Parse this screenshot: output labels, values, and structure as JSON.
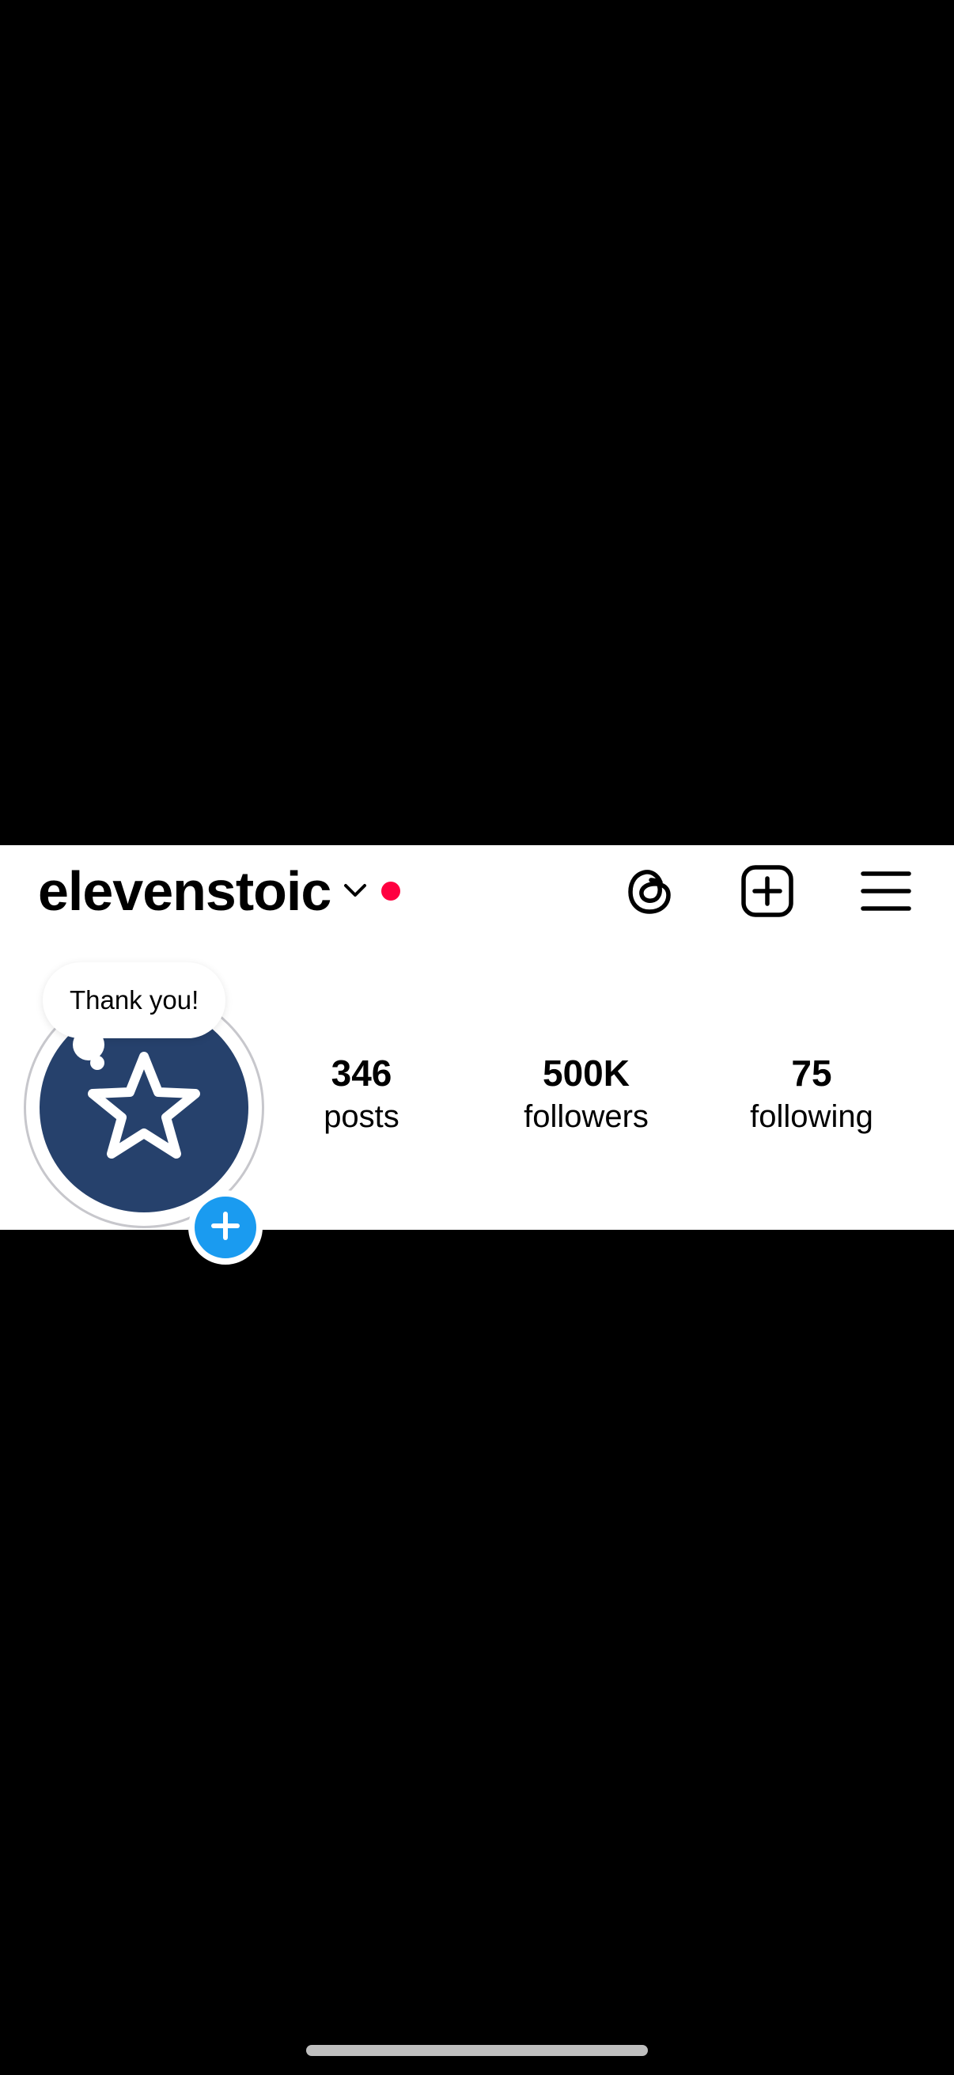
{
  "header": {
    "username": "elevenstoic",
    "icons": {
      "dropdown": "chevron-down-icon",
      "notification": "notification-dot",
      "threads": "threads-icon",
      "create": "create-post-icon",
      "menu": "hamburger-menu-icon"
    }
  },
  "profile": {
    "note": "Thank you!",
    "avatar_icon": "star-icon",
    "add_story_icon": "plus-icon",
    "stats": {
      "posts": {
        "value": "346",
        "label": "posts"
      },
      "followers": {
        "value": "500K",
        "label": "followers"
      },
      "following": {
        "value": "75",
        "label": "following"
      }
    }
  },
  "colors": {
    "background": "#000000",
    "panel": "#ffffff",
    "avatar": "#26416c",
    "accent_blue": "#1a9bf0",
    "notification_dot": "#ff0040"
  }
}
